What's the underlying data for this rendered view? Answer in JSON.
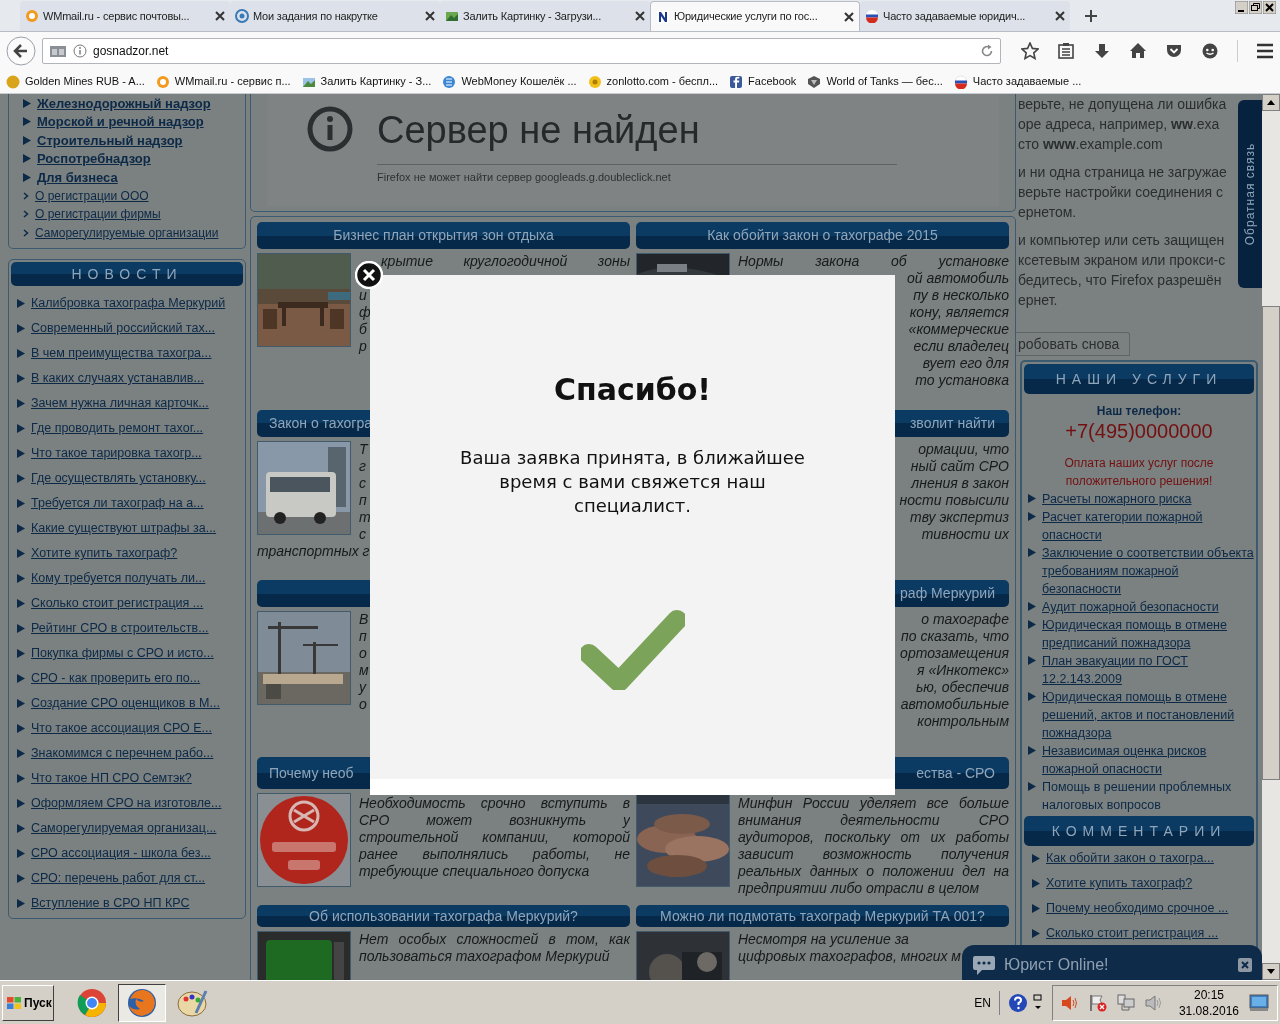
{
  "browser": {
    "tabs": [
      {
        "title": "WMmail.ru - сервис почтовы...",
        "selected": false
      },
      {
        "title": "Мои задания по накрутке",
        "selected": false
      },
      {
        "title": "Залить Картинку - Загрузи...",
        "selected": false
      },
      {
        "title": "Юридические услуги по гос...",
        "selected": true
      },
      {
        "title": "Часто задаваемые юридич...",
        "selected": false
      }
    ],
    "address": "gosnadzor.net",
    "bookmarks": [
      "Golden Mines RUB - A...",
      "WMmail.ru - сервис п...",
      "Залить Картинку - З...",
      "WebMoney Кошелёк ...",
      "zonlotto.com - беспл...",
      "Facebook",
      "World of Tanks — бес...",
      "Часто задаваемые ..."
    ]
  },
  "sidebar": {
    "menu": [
      {
        "label": "Железнодорожный надзор",
        "kind": "main"
      },
      {
        "label": "Морской и речной надзор",
        "kind": "main"
      },
      {
        "label": "Строительный надзор",
        "kind": "main"
      },
      {
        "label": "Роспотребнадзор",
        "kind": "main"
      },
      {
        "label": "Для бизнеса",
        "kind": "main"
      },
      {
        "label": "О регистрации ООО",
        "kind": "sub"
      },
      {
        "label": "О регистрации фирмы",
        "kind": "sub"
      },
      {
        "label": "Саморегулируемые организации",
        "kind": "sub"
      }
    ],
    "news": {
      "title": "НОВОСТИ",
      "items": [
        "Калибровка тахографа Меркурий",
        "Современный российский тах...",
        "В чем преимущества тахогра...",
        "В каких случаях устанавлив...",
        "Зачем нужна личная карточк...",
        "Где проводить ремонт тахог...",
        "Что такое тарировка тахогр...",
        "Где осуществлять установку...",
        "Требуется ли тахограф на а...",
        "Какие существуют штрафы за...",
        "Хотите купить тахограф?",
        "Кому требуется получать ли...",
        "Сколько стоит регистрация ...",
        "Рейтинг СРО в строительств...",
        "Покупка фирмы с СРО и исто...",
        "СРО - как проверить его по...",
        "Создание СРО оценщиков в М...",
        "Что такое ассоциация СРО Е...",
        "Знакомимся с перечнем рабо...",
        "Что такое НП СРО Семтэк?",
        "Оформляем СРО на изготовле...",
        "Саморегулируемая организац...",
        "СРО ассоциация - школа без...",
        "СРО: перечень работ для ст...",
        "Вступление в СРО НП КРС"
      ]
    }
  },
  "error_frame": {
    "heading": "Сервер не найден",
    "message": "Firefox не может найти сервер googleads.g.doubleclick.net"
  },
  "articles": [
    {
      "header": {
        "text": "Бизнес план открытия зон отдыха",
        "kind": "whole"
      },
      "image": {
        "kind": "picture"
      },
      "lines": [
        {
          "text": "крытие круглогодичной зоны",
          "kind": "whole"
        },
        {
          "text": "и",
          "kind": "cut_right"
        },
        {
          "text": "ф",
          "kind": "cut_right"
        },
        {
          "text": "б",
          "kind": "cut_right"
        },
        {
          "text": "р",
          "kind": "cut_right"
        }
      ]
    },
    {
      "header": {
        "text": "Как обойти закон о тахографе 2015",
        "kind": "whole"
      },
      "image": {
        "kind": "picture"
      },
      "lines": [
        {
          "text": "Нормы закона об установке",
          "kind": "whole"
        },
        {
          "text": "ой автомобиль",
          "kind": "cut_left"
        },
        {
          "text": "пу в несколько",
          "kind": "cut_left"
        },
        {
          "text": "кону, является",
          "kind": "cut_left"
        },
        {
          "text": "«коммерческие",
          "kind": "cut_left"
        },
        {
          "text": "если владелец",
          "kind": "cut_left"
        },
        {
          "text": "вует его для",
          "kind": "cut_left"
        },
        {
          "text": "то установка",
          "kind": "cut_left"
        }
      ]
    },
    {
      "header": {
        "text": "Закон о тахогра",
        "kind": "cut_right"
      },
      "image": {
        "kind": "picture"
      },
      "lines": [
        {
          "text": "Т",
          "kind": "cut_right"
        },
        {
          "text": "г",
          "kind": "cut_right"
        },
        {
          "text": "с",
          "kind": "cut_right"
        },
        {
          "text": "п",
          "kind": "cut_right"
        },
        {
          "text": "т",
          "kind": "cut_right"
        },
        {
          "text": "с",
          "kind": "cut_right"
        }
      ],
      "tail": "транспортных г"
    },
    {
      "header": {
        "text": "зволит найти",
        "kind": "cut_left"
      },
      "lines": [
        {
          "text": "ормации, что",
          "kind": "cut_left"
        },
        {
          "text": "ный сайт СРО",
          "kind": "cut_left"
        },
        {
          "text": "лнения в закон",
          "kind": "cut_left"
        },
        {
          "text": "ности повысили",
          "kind": "cut_left"
        },
        {
          "text": "тву экспертиз",
          "kind": "cut_left"
        },
        {
          "text": "тивности их",
          "kind": "cut_left"
        }
      ]
    },
    {
      "image": {
        "kind": "picture"
      },
      "lines": [
        {
          "text": "В",
          "kind": "cut_right"
        },
        {
          "text": "п",
          "kind": "cut_right"
        },
        {
          "text": "о",
          "kind": "cut_right"
        },
        {
          "text": "м",
          "kind": "cut_right"
        },
        {
          "text": "у",
          "kind": "cut_right"
        },
        {
          "text": "о",
          "kind": "cut_right"
        }
      ]
    },
    {
      "header": {
        "text": "раф Меркурий",
        "kind": "cut_left"
      },
      "lines": [
        {
          "text": "о тахографе",
          "kind": "cut_left"
        },
        {
          "text": "по сказать, что",
          "kind": "cut_left"
        },
        {
          "text": "ортозамещения",
          "kind": "cut_left"
        },
        {
          "text": "я «Инкотекс»",
          "kind": "cut_left"
        },
        {
          "text": "ью, обеспечив",
          "kind": "cut_left"
        },
        {
          "text": "автомобильные",
          "kind": "cut_left"
        },
        {
          "text": "контрольным",
          "kind": "cut_left"
        }
      ]
    },
    {
      "header": {
        "text": "Почему необ",
        "kind": "cut_right"
      },
      "image": {
        "kind": "picture"
      },
      "text": "Необходимость срочно вступить в СРО может возникнуть у строительной компании, которой ранее выполнялись работы, не требующие специального допуска"
    },
    {
      "header": {
        "text": "ества - СРО",
        "kind": "cut_left"
      },
      "image": {
        "kind": "picture"
      },
      "text": "Минфин России уделяет все больше внимания деятельности СРО аудиторов, поскольку от их работы зависит возможность получения реальных данных о положении дел на предприятии либо отрасли в целом"
    },
    {
      "header": {
        "text": "Об использовании тахографа Меркурий?",
        "kind": "whole"
      },
      "image": {
        "kind": "picture"
      },
      "text": "Нет особых сложностей в том, как пользоваться тахографом Меркурий"
    },
    {
      "header": {
        "text": "Можно ли подмотать тахограф Меркурий ТА 001?",
        "kind": "whole"
      },
      "image": {
        "kind": "picture"
      },
      "lines": [
        {
          "text": "Несмотря на усиление за",
          "kind": "cut_right"
        },
        {
          "text": "цифровых тахографов, многих м",
          "kind": "cut_right"
        }
      ]
    }
  ],
  "side_frame": {
    "lines": [
      "верьте, не допущена ли ошибка",
      "оре адреса, например, **ww**.exa",
      "сто **www**.example.com",
      "и ни одна страница не загружае",
      "верьте настройки соединения с",
      "ернетом.",
      "и компьютер или сеть защищен",
      "ксетевым экраном или прокси-с",
      "бедитесь, что Firefox разрешён",
      "ернет."
    ],
    "retry": "робовать снова"
  },
  "services": {
    "title": "НАШИ УСЛУГИ",
    "phone_label": "Наш телефон:",
    "phone": "+7(495)0000000",
    "note": "Оплата наших услуг после положительного решения!",
    "items": [
      {
        "label": "Расчеты пожарного риска",
        "link": true
      },
      {
        "label": "Расчет категории пожарной опасности",
        "link": true
      },
      {
        "label": "Заключение о соответствии объекта требованиям пожарной безопасности",
        "link": true
      },
      {
        "label": "Аудит пожарной безопасности",
        "link": true
      },
      {
        "label": "Юридическая помощь в отмене предписаний пожнадзора",
        "link": true
      },
      {
        "label": "План эвакуации по ГОСТ 12.2.143.2009",
        "link": true
      },
      {
        "label": "Юридическая помощь в отмене решений, актов и постановлений пожнадзора",
        "link": true
      },
      {
        "label": "Независимая оценка рисков пожарной опасности",
        "link": true
      },
      {
        "label": "Помощь в решении проблемных налоговых вопросов",
        "link": false
      }
    ]
  },
  "comments": {
    "title": "КОММЕНТАРИИ",
    "items": [
      "Как обойти закон о тахогра...",
      "Хотите купить тахограф?",
      "Почему необходимо срочное ...",
      "Сколько стоит регистрация ..."
    ]
  },
  "feedback_tab": "Обратная связь",
  "chat": {
    "label": "Юрист Online!"
  },
  "modal": {
    "title": "Спасибо!",
    "message": "Ваша заявка принята, в ближайшее время с вами свяжется наш специалист."
  },
  "taskbar": {
    "start": "Пуск",
    "apps": [
      {
        "kind": "ball",
        "selected": false
      },
      {
        "kind": "fox",
        "selected": true
      },
      {
        "kind": "palette",
        "selected": false
      }
    ],
    "language": "EN",
    "time": "20:15",
    "date": "31.08.2016"
  }
}
